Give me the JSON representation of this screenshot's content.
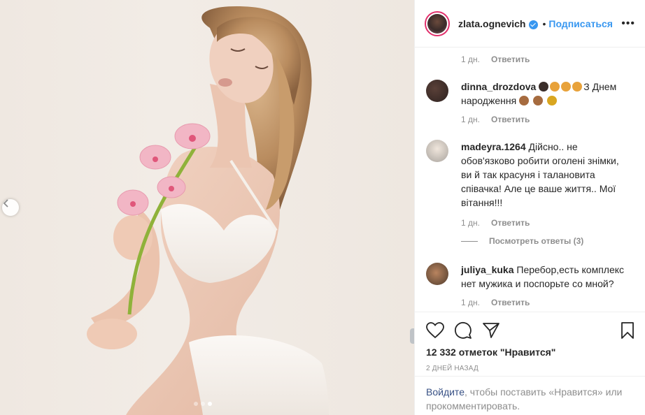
{
  "post": {
    "username": "zlata.ognevich",
    "separator": "•",
    "follow_label": "Подписаться",
    "more_label": "•••"
  },
  "comments": {
    "top_meta": {
      "time": "1 дн.",
      "reply": "Ответить"
    },
    "items": [
      {
        "username": "dinna_drozdova",
        "text": "З Днем народження",
        "time": "1 дн.",
        "reply": "Ответить"
      },
      {
        "username": "madeyra.1264",
        "text": "Дійсно.. не обов'язково робити оголені знімки, ви й так красуня і талановита співачка! Але це ваше життя.. Мої вітання!!!",
        "time": "1 дн.",
        "reply": "Ответить",
        "view_replies": "Посмотреть ответы (3)"
      },
      {
        "username": "juliya_kuka",
        "text": "Перебор,есть комплекс нет мужика и поспорьте со мной?",
        "time": "1 дн.",
        "reply": "Ответить"
      }
    ]
  },
  "engagement": {
    "likes": "12 332 отметок \"Нравится\"",
    "date": "2 ДНЕЙ НАЗАД"
  },
  "login_prompt": {
    "link": "Войдите",
    "text": ", чтобы поставить «Нравится» или прокомментировать."
  },
  "carousel": {
    "total": 3,
    "active": 3
  },
  "icons": [
    "heart-icon",
    "comment-icon",
    "share-icon",
    "bookmark-icon",
    "chevron-left-icon",
    "verified-icon"
  ],
  "colors": {
    "link_blue": "#3897f0",
    "login_link": "#385185",
    "muted": "#8e8e8e",
    "text": "#262626"
  }
}
